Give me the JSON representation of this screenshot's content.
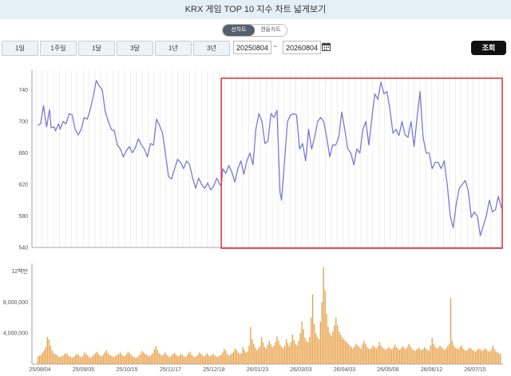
{
  "window": {
    "title": "KRX 게임 TOP 10 지수 차트 넓게보기"
  },
  "chart_toggle": {
    "line_label": "선차트",
    "candle_label": "캔들차트"
  },
  "periods": [
    "1일",
    "1주일",
    "1달",
    "3달",
    "1년",
    "3년"
  ],
  "date_range": {
    "start": "20250804",
    "separator": "~",
    "end": "20260804"
  },
  "query_button": "조회",
  "colors": {
    "price_line": "#7b78d8",
    "volume_bar": "#e8a24a",
    "highlight_box": "#e0303a",
    "title_bg": "#e5f0f6"
  },
  "chart_data": {
    "type": "line",
    "price_axis": {
      "ticks": [
        540,
        580,
        620,
        660,
        700,
        740
      ],
      "ylim": [
        540,
        765
      ]
    },
    "volume_axis": {
      "ticks": [
        "4,000,000",
        "8,000,000",
        "12백만"
      ],
      "ylim": [
        0,
        13000000
      ]
    },
    "x_ticks": [
      "25/08/04",
      "25/09/05",
      "25/10/15",
      "25/11/17",
      "25/12/18",
      "26/01/23",
      "26/03/03",
      "26/04/03",
      "26/05/08",
      "26/06/12",
      "26/07/15"
    ],
    "price_series": [
      [
        0,
        695
      ],
      [
        2,
        697
      ],
      [
        4,
        720
      ],
      [
        6,
        693
      ],
      [
        8,
        715
      ],
      [
        9,
        692
      ],
      [
        11,
        693
      ],
      [
        12,
        688
      ],
      [
        14,
        697
      ],
      [
        15,
        690
      ],
      [
        17,
        700
      ],
      [
        19,
        697
      ],
      [
        21,
        710
      ],
      [
        23,
        708
      ],
      [
        25,
        690
      ],
      [
        27,
        683
      ],
      [
        29,
        690
      ],
      [
        31,
        705
      ],
      [
        33,
        703
      ],
      [
        35,
        715
      ],
      [
        37,
        732
      ],
      [
        39,
        752
      ],
      [
        41,
        745
      ],
      [
        43,
        740
      ],
      [
        45,
        712
      ],
      [
        47,
        700
      ],
      [
        49,
        690
      ],
      [
        51,
        688
      ],
      [
        53,
        670
      ],
      [
        55,
        665
      ],
      [
        57,
        655
      ],
      [
        59,
        663
      ],
      [
        61,
        668
      ],
      [
        63,
        660
      ],
      [
        65,
        667
      ],
      [
        67,
        678
      ],
      [
        69,
        670
      ],
      [
        71,
        665
      ],
      [
        73,
        655
      ],
      [
        75,
        672
      ],
      [
        77,
        670
      ],
      [
        79,
        703
      ],
      [
        81,
        695
      ],
      [
        83,
        685
      ],
      [
        85,
        658
      ],
      [
        87,
        630
      ],
      [
        89,
        627
      ],
      [
        91,
        640
      ],
      [
        93,
        652
      ],
      [
        95,
        648
      ],
      [
        97,
        640
      ],
      [
        99,
        650
      ],
      [
        101,
        645
      ],
      [
        103,
        628
      ],
      [
        105,
        615
      ],
      [
        107,
        628
      ],
      [
        109,
        620
      ],
      [
        111,
        615
      ],
      [
        113,
        622
      ],
      [
        115,
        613
      ],
      [
        117,
        618
      ],
      [
        119,
        628
      ],
      [
        121,
        620
      ],
      [
        122,
        618
      ],
      [
        123,
        640
      ],
      [
        125,
        634
      ],
      [
        127,
        644
      ],
      [
        129,
        636
      ],
      [
        131,
        623
      ],
      [
        133,
        640
      ],
      [
        135,
        650
      ],
      [
        137,
        633
      ],
      [
        139,
        650
      ],
      [
        141,
        660
      ],
      [
        143,
        645
      ],
      [
        145,
        690
      ],
      [
        147,
        710
      ],
      [
        149,
        700
      ],
      [
        151,
        672
      ],
      [
        153,
        675
      ],
      [
        155,
        710
      ],
      [
        157,
        705
      ],
      [
        159,
        714
      ],
      [
        161,
        610
      ],
      [
        162,
        600
      ],
      [
        164,
        650
      ],
      [
        166,
        700
      ],
      [
        168,
        708
      ],
      [
        170,
        710
      ],
      [
        172,
        708
      ],
      [
        174,
        665
      ],
      [
        176,
        672
      ],
      [
        178,
        650
      ],
      [
        180,
        690
      ],
      [
        182,
        665
      ],
      [
        184,
        680
      ],
      [
        186,
        700
      ],
      [
        188,
        705
      ],
      [
        190,
        700
      ],
      [
        192,
        680
      ],
      [
        194,
        655
      ],
      [
        196,
        670
      ],
      [
        198,
        670
      ],
      [
        200,
        680
      ],
      [
        202,
        712
      ],
      [
        204,
        690
      ],
      [
        206,
        665
      ],
      [
        208,
        660
      ],
      [
        210,
        645
      ],
      [
        212,
        665
      ],
      [
        214,
        660
      ],
      [
        216,
        690
      ],
      [
        218,
        700
      ],
      [
        220,
        670
      ],
      [
        222,
        705
      ],
      [
        224,
        735
      ],
      [
        226,
        728
      ],
      [
        228,
        750
      ],
      [
        230,
        735
      ],
      [
        232,
        738
      ],
      [
        234,
        715
      ],
      [
        236,
        685
      ],
      [
        238,
        690
      ],
      [
        240,
        682
      ],
      [
        242,
        700
      ],
      [
        244,
        683
      ],
      [
        246,
        680
      ],
      [
        248,
        700
      ],
      [
        250,
        668
      ],
      [
        252,
        705
      ],
      [
        254,
        738
      ],
      [
        256,
        680
      ],
      [
        258,
        660
      ],
      [
        260,
        660
      ],
      [
        262,
        640
      ],
      [
        264,
        648
      ],
      [
        266,
        648
      ],
      [
        268,
        640
      ],
      [
        270,
        650
      ],
      [
        272,
        620
      ],
      [
        274,
        580
      ],
      [
        276,
        565
      ],
      [
        278,
        595
      ],
      [
        280,
        615
      ],
      [
        282,
        620
      ],
      [
        284,
        625
      ],
      [
        286,
        612
      ],
      [
        288,
        578
      ],
      [
        290,
        585
      ],
      [
        292,
        580
      ],
      [
        294,
        555
      ],
      [
        296,
        568
      ],
      [
        298,
        580
      ],
      [
        300,
        600
      ],
      [
        302,
        585
      ],
      [
        304,
        588
      ],
      [
        306,
        605
      ],
      [
        308,
        590
      ]
    ],
    "volume_series": [
      1,
      1.1,
      1.2,
      1.5,
      1.8,
      2.2,
      3.5,
      3.2,
      2.4,
      1.8,
      1.4,
      1.3,
      1.2,
      1.0,
      0.9,
      1.0,
      1.1,
      1.3,
      1.4,
      1.2,
      1.0,
      0.9,
      0.8,
      0.9,
      1.1,
      1.3,
      1.2,
      1.0,
      0.9,
      1.1,
      1.5,
      1.3,
      1.1,
      0.9,
      0.8,
      1.0,
      1.2,
      1.4,
      1.6,
      1.3,
      1.1,
      1.0,
      1.2,
      1.5,
      1.8,
      1.4,
      1.2,
      1.1,
      1.0,
      0.9,
      1.1,
      1.2,
      1.3,
      1.5,
      1.2,
      1.0,
      1.1,
      1.3,
      1.6,
      1.4,
      1.2,
      1.0,
      0.9,
      0.8,
      0.9,
      1.1,
      1.3,
      1.7,
      1.5,
      1.3,
      1.2,
      1.1,
      1.0,
      1.2,
      1.4,
      1.9,
      2.3,
      1.8,
      1.4,
      1.2,
      1.1,
      1.3,
      1.5,
      1.2,
      1.0,
      0.9,
      1.1,
      1.3,
      1.4,
      1.2,
      1.0,
      1.1,
      1.3,
      1.2,
      1.0,
      0.9,
      1.1,
      1.4,
      1.6,
      1.2,
      1.0,
      0.9,
      1.0,
      1.2,
      1.5,
      1.3,
      1.1,
      1.0,
      1.2,
      1.4,
      1.1,
      1.0,
      1.2,
      1.3,
      1.1,
      1.0,
      0.9,
      1.1,
      1.2,
      1.5,
      2.0,
      1.7,
      1.3,
      1.1,
      1.2,
      1.4,
      1.6,
      2.0,
      1.8,
      1.5,
      1.3,
      1.4,
      2.2,
      1.8,
      1.5,
      1.6,
      2.4,
      4.8,
      3.2,
      2.6,
      2.1,
      1.8,
      2.0,
      2.3,
      3.5,
      2.8,
      2.2,
      2.0,
      2.5,
      3.0,
      2.6,
      2.2,
      2.4,
      2.8,
      3.6,
      3.0,
      2.5,
      2.2,
      2.0,
      2.4,
      3.2,
      2.7,
      2.3,
      2.8,
      3.8,
      3.1,
      2.6,
      2.4,
      3.0,
      4.0,
      5.5,
      4.5,
      3.4,
      3.0,
      2.8,
      3.5,
      6.0,
      9.0,
      5.2,
      4.0,
      3.5,
      3.2,
      5.5,
      8.0,
      12.5,
      9.5,
      6.5,
      4.8,
      4.0,
      3.6,
      4.2,
      5.0,
      6.0,
      5.0,
      4.2,
      3.8,
      3.5,
      3.2,
      3.0,
      2.8,
      2.6,
      2.4,
      2.2,
      2.0,
      2.3,
      2.6,
      2.4,
      2.2,
      2.0,
      2.5,
      3.0,
      2.6,
      2.2,
      2.0,
      1.9,
      2.1,
      2.4,
      2.2,
      2.0,
      2.3,
      2.8,
      2.4,
      2.1,
      2.0,
      1.8,
      2.0,
      2.2,
      2.0,
      1.9,
      2.1,
      2.5,
      2.2,
      2.0,
      1.8,
      2.0,
      2.3,
      2.1,
      1.9,
      2.2,
      2.6,
      2.3,
      2.0,
      1.8,
      1.7,
      1.9,
      2.1,
      2.0,
      1.8,
      1.9,
      2.2,
      2.0,
      1.8,
      1.7,
      2.4,
      3.4,
      2.6,
      2.2,
      2.0,
      2.1,
      2.4,
      2.2,
      2.0,
      1.8,
      2.0,
      2.3,
      2.6,
      8.5,
      3.0,
      2.4,
      2.1,
      2.0,
      1.9,
      2.2,
      2.4,
      2.0,
      1.8,
      1.7,
      1.9,
      2.1,
      2.0,
      1.8,
      1.7,
      1.6,
      1.8,
      2.0,
      1.9,
      1.7,
      1.8,
      2.0,
      1.9,
      1.7,
      1.6,
      1.8,
      2.4,
      2.0,
      1.7,
      1.5,
      1.4,
      1.3
    ]
  }
}
